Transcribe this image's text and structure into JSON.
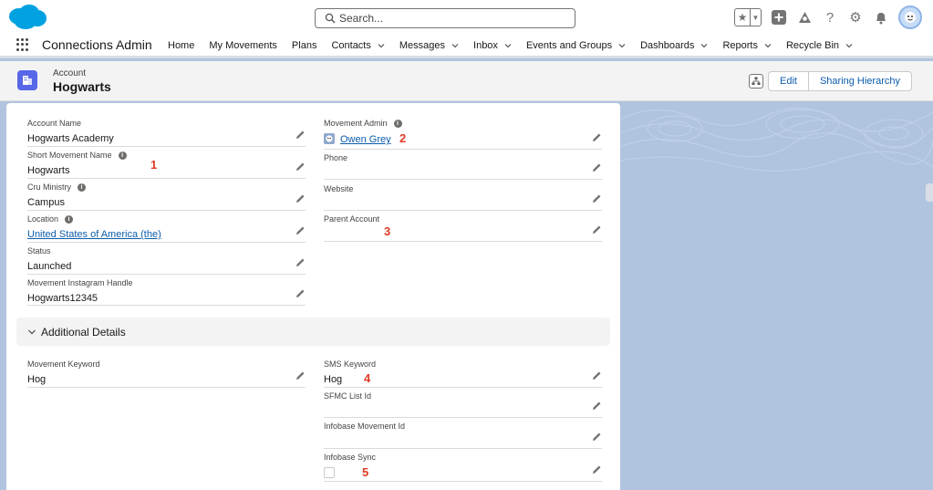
{
  "header": {
    "search_placeholder": "Search...",
    "icons": [
      "salesforce-logo",
      "search-icon",
      "favorites-star-icon",
      "favorites-dropdown-icon",
      "global-actions-icon",
      "trailhead-icon",
      "help-icon",
      "setup-gear-icon",
      "notifications-bell-icon",
      "user-avatar"
    ]
  },
  "nav": {
    "app_name": "Connections Admin",
    "items": [
      {
        "label": "Home",
        "dropdown": false
      },
      {
        "label": "My Movements",
        "dropdown": false
      },
      {
        "label": "Plans",
        "dropdown": false
      },
      {
        "label": "Contacts",
        "dropdown": true
      },
      {
        "label": "Messages",
        "dropdown": true
      },
      {
        "label": "Inbox",
        "dropdown": true
      },
      {
        "label": "Events and Groups",
        "dropdown": true
      },
      {
        "label": "Dashboards",
        "dropdown": true
      },
      {
        "label": "Reports",
        "dropdown": true
      },
      {
        "label": "Recycle Bin",
        "dropdown": true
      }
    ]
  },
  "record": {
    "type": "Account",
    "title": "Hogwarts",
    "actions": {
      "edit": "Edit",
      "sharing": "Sharing Hierarchy"
    }
  },
  "fields": {
    "account_name": {
      "label": "Account Name",
      "value": "Hogwarts Academy"
    },
    "short_movement_name": {
      "label": "Short Movement Name",
      "value": "Hogwarts"
    },
    "cru_ministry": {
      "label": "Cru Ministry",
      "value": "Campus"
    },
    "location": {
      "label": "Location",
      "value": "United States of America (the)"
    },
    "status": {
      "label": "Status",
      "value": "Launched"
    },
    "instagram": {
      "label": "Movement Instagram Handle",
      "value": "Hogwarts12345"
    },
    "movement_admin": {
      "label": "Movement Admin",
      "value": "Owen Grey"
    },
    "phone": {
      "label": "Phone",
      "value": ""
    },
    "website": {
      "label": "Website",
      "value": ""
    },
    "parent_account": {
      "label": "Parent Account",
      "value": ""
    }
  },
  "additional": {
    "section_title": "Additional Details",
    "movement_keyword": {
      "label": "Movement Keyword",
      "value": "Hog"
    },
    "sms_keyword": {
      "label": "SMS Keyword",
      "value": "Hog"
    },
    "sfmc_list_id": {
      "label": "SFMC List Id",
      "value": ""
    },
    "infobase_movement_id": {
      "label": "Infobase Movement Id",
      "value": ""
    },
    "infobase_sync": {
      "label": "Infobase Sync",
      "checked": false
    }
  },
  "annotations": [
    "1",
    "2",
    "3",
    "4",
    "5"
  ],
  "colors": {
    "brand": "#0b5cab",
    "record_icon": "#5867e8",
    "annotation": "#e03b24",
    "background": "#b0c4df"
  }
}
